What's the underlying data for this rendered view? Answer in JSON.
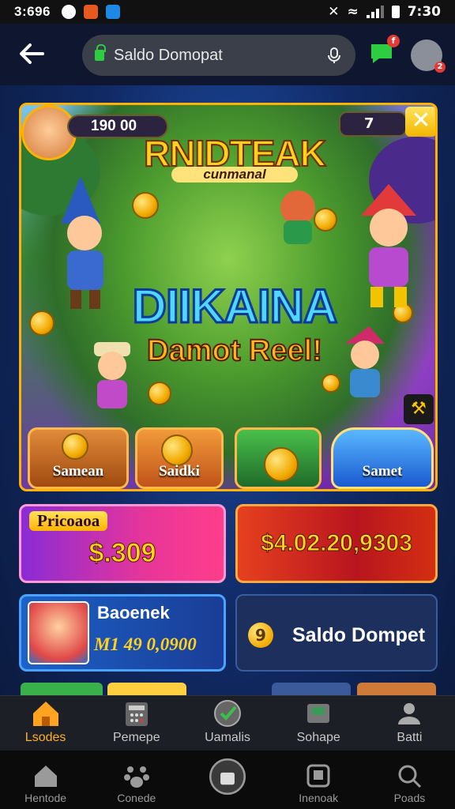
{
  "status_bar": {
    "time_left": "3:696",
    "time_right": "7:30",
    "signal_level": 0.75
  },
  "address_bar": {
    "text": "Saldo Domopat"
  },
  "banner": {
    "score": "190 00",
    "gems": "7",
    "logo": "RNIDTEAK",
    "logo_sub": "cunmanal",
    "headline": "DIIKAINA",
    "subline": "Damot Reel!",
    "categories": [
      {
        "label": "Samean",
        "color": "#c0621a"
      },
      {
        "label": "Saidki",
        "color": "#d9781c"
      },
      {
        "label": "",
        "color": "#3a9a3a"
      },
      {
        "label": "Samet",
        "color": "#2a8ad8"
      }
    ]
  },
  "cards": {
    "promo_tag": "Pricoaoa",
    "promo_value": "$.309",
    "jackpot_value": "$4.02.20,9303",
    "bonus_title": "Baoenek",
    "bonus_value": "M1 49 0,0900",
    "wallet_badge": "9",
    "wallet_label": "Saldo Dompet"
  },
  "game_nav": [
    {
      "label": "Lsodes",
      "icon": "home-icon",
      "active": true
    },
    {
      "label": "Pemepe",
      "icon": "calculator-icon",
      "active": false
    },
    {
      "label": "Uamalis",
      "icon": "ticket-icon",
      "active": false
    },
    {
      "label": "Sohape",
      "icon": "deposit-icon",
      "active": false
    },
    {
      "label": "Batti",
      "icon": "profile-icon",
      "active": false
    }
  ],
  "system_nav": [
    {
      "label": "Hentode",
      "icon": "home-icon"
    },
    {
      "label": "Conede",
      "icon": "paw-icon"
    },
    {
      "label": "",
      "icon": "bag-icon"
    },
    {
      "label": "Inenoak",
      "icon": "tablet-icon"
    },
    {
      "label": "Poads",
      "icon": "search-icon"
    }
  ]
}
